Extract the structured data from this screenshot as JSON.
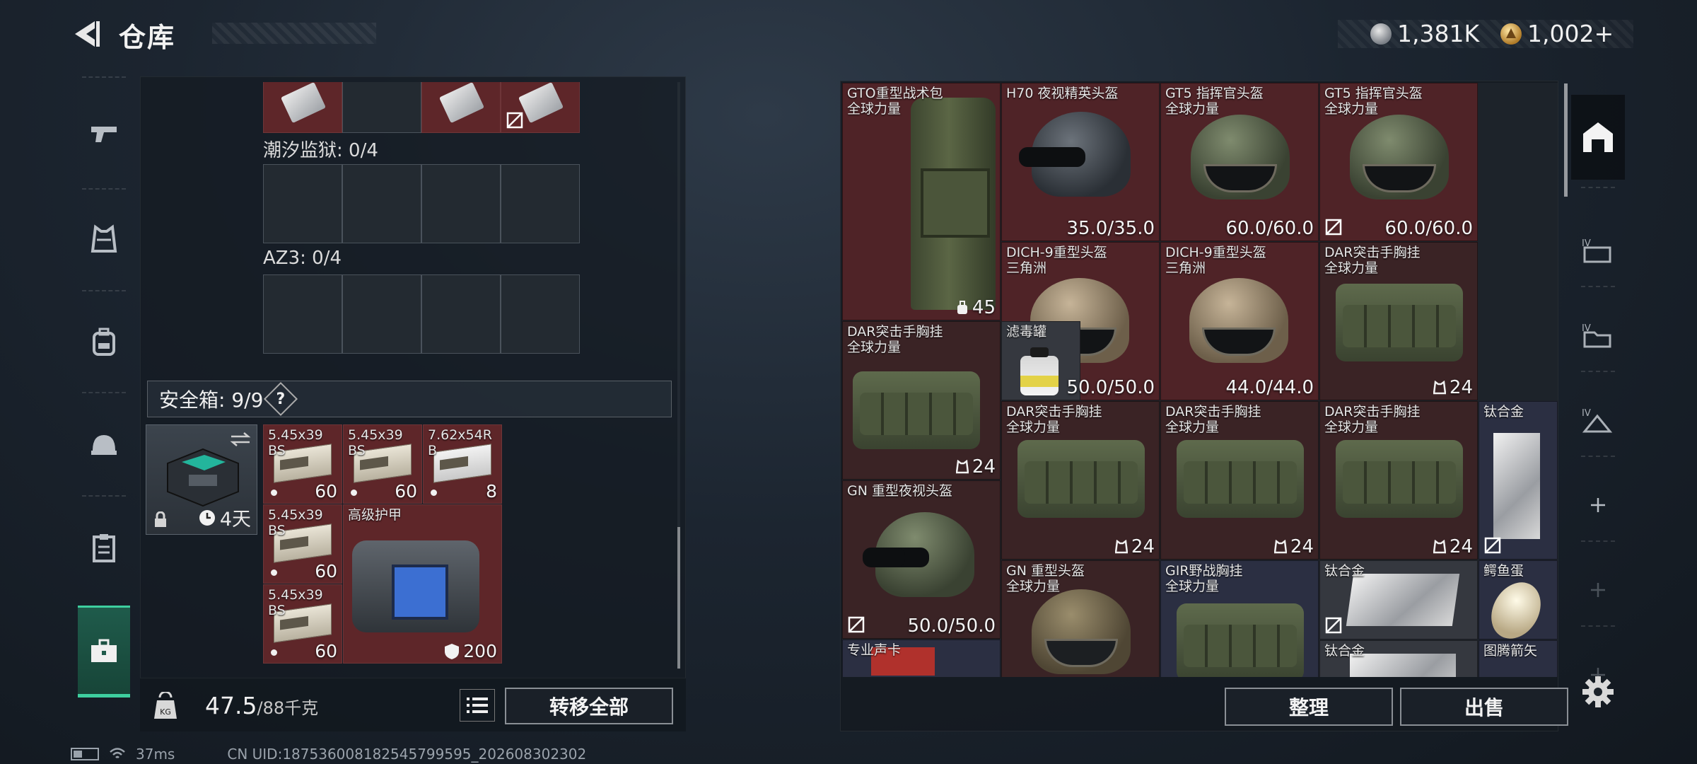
{
  "header": {
    "title": "仓库",
    "currency_silver": "1,381K",
    "currency_gold": "1,002+"
  },
  "left_nav": {
    "items": [
      {
        "id": "weapons",
        "icon": "pistol-icon"
      },
      {
        "id": "armor",
        "icon": "vest-icon"
      },
      {
        "id": "backpack",
        "icon": "backpack-icon"
      },
      {
        "id": "helmet",
        "icon": "helmet-icon"
      },
      {
        "id": "clipboard",
        "icon": "clipboard-icon"
      },
      {
        "id": "toolbox",
        "icon": "toolbox-icon",
        "active": true
      }
    ]
  },
  "left_panel": {
    "slot_tidal": "潮汐监狱: 0/4",
    "slot_az3": "AZ3: 0/4",
    "safe_box": {
      "label": "安全箱: 9/9",
      "help": "?",
      "timer": "4天"
    },
    "safe_items": [
      {
        "name": "5.45x39\nBS",
        "value": "60"
      },
      {
        "name": "5.45x39\nBS",
        "value": "60"
      },
      {
        "name": "7.62x54R\nB",
        "value": "8"
      },
      {
        "name": "5.45x39\nBS",
        "value": "60"
      },
      {
        "name": "5.45x39\nBS",
        "value": "60"
      },
      {
        "name": "高级护甲",
        "value": "200"
      }
    ],
    "weight_current": "47.5",
    "weight_max": "/88千克",
    "transfer_all": "转移全部"
  },
  "inventory": {
    "items": {
      "gto": {
        "name": "GTO重型战术包\n全球力量",
        "value": "45"
      },
      "h70": {
        "name": "H70 夜视精英头盔",
        "value": "35.0/35.0"
      },
      "gt5a": {
        "name": "GT5 指挥官头盔\n全球力量",
        "value": "60.0/60.0"
      },
      "gt5b": {
        "name": "GT5 指挥官头盔\n全球力量",
        "value": "60.0/60.0"
      },
      "dich_a": {
        "name": "DICH-9重型头盔\n三角洲",
        "value": "50.0/50.0"
      },
      "dich_b": {
        "name": "DICH-9重型头盔\n三角洲",
        "value": "44.0/44.0"
      },
      "dar1": {
        "name": "DAR突击手胸挂\n全球力量",
        "value": "24"
      },
      "dar2": {
        "name": "DAR突击手胸挂\n全球力量",
        "value": "24"
      },
      "filter": {
        "name": "滤毒罐"
      },
      "dar3": {
        "name": "DAR突击手胸挂\n全球力量",
        "value": "24"
      },
      "dar4": {
        "name": "DAR突击手胸挂\n全球力量",
        "value": "24"
      },
      "dar5": {
        "name": "DAR突击手胸挂\n全球力量",
        "value": "24"
      },
      "ti1": {
        "name": "钛合金"
      },
      "gn_nv": {
        "name": "GN 重型夜视头盔",
        "value": "50.0/50.0"
      },
      "gn_heavy": {
        "name": "GN 重型头盔\n全球力量"
      },
      "gir": {
        "name": "GIR野战胸挂\n全球力量"
      },
      "ti2": {
        "name": "钛合金"
      },
      "egg": {
        "name": "鳄鱼蛋"
      },
      "card": {
        "name": "专业声卡"
      },
      "ti3": {
        "name": "钛合金"
      },
      "arrow": {
        "name": "图腾箭矢"
      }
    },
    "sort": "整理",
    "sell": "出售"
  },
  "status_bar": {
    "ping": "37ms",
    "uid": "CN UID:187536008182545799595_202608302302"
  }
}
